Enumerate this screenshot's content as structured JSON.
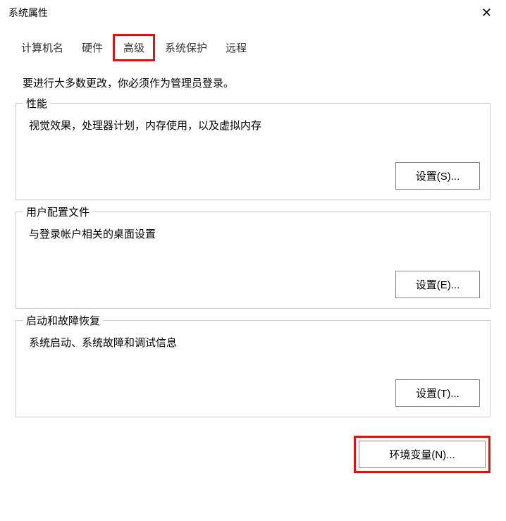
{
  "window": {
    "title": "系统属性",
    "close": "✕"
  },
  "tabs": {
    "computer_name": "计算机名",
    "hardware": "硬件",
    "advanced": "高级",
    "system_protection": "系统保护",
    "remote": "远程"
  },
  "intro": "要进行大多数更改，你必须作为管理员登录。",
  "groups": {
    "performance": {
      "title": "性能",
      "desc": "视觉效果，处理器计划，内存使用，以及虚拟内存",
      "button": "设置(S)..."
    },
    "user_profiles": {
      "title": "用户配置文件",
      "desc": "与登录帐户相关的桌面设置",
      "button": "设置(E)..."
    },
    "startup_recovery": {
      "title": "启动和故障恢复",
      "desc": "系统启动、系统故障和调试信息",
      "button": "设置(T)..."
    }
  },
  "env_button": "环境变量(N)..."
}
